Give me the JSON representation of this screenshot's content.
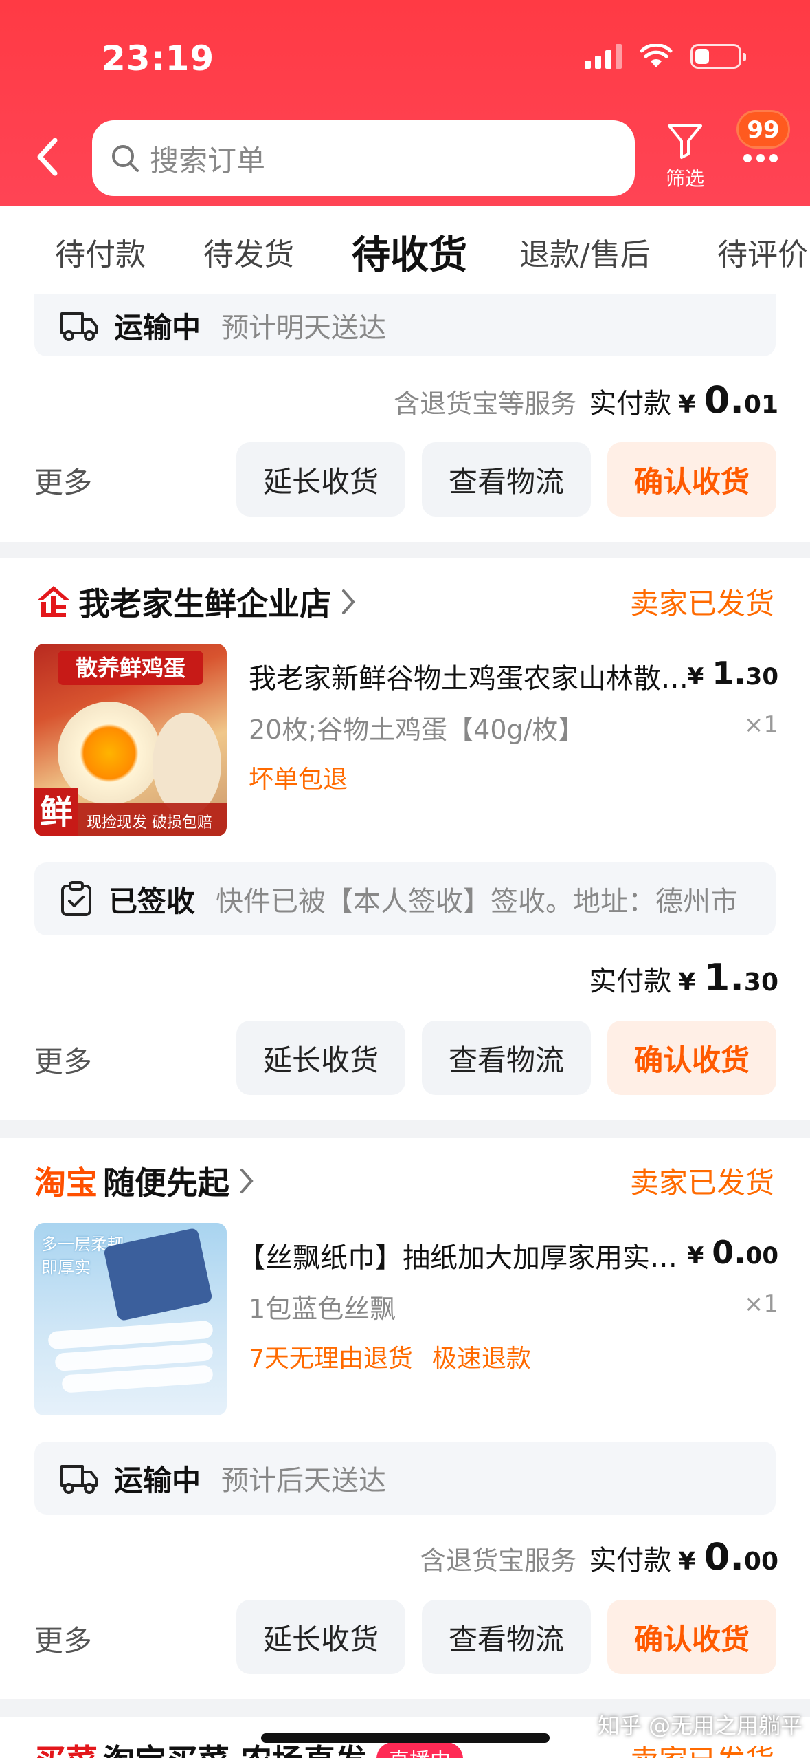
{
  "status_bar": {
    "time": "23:19"
  },
  "header": {
    "search_placeholder": "搜索订单",
    "filter_label": "筛选",
    "message_count": "99"
  },
  "tabs": [
    {
      "label": "待付款"
    },
    {
      "label": "待发货"
    },
    {
      "label": "待收货",
      "active": true
    },
    {
      "label": "退款/售后"
    },
    {
      "label": "待评价"
    }
  ],
  "orders": [
    {
      "logistics_status": "运输中",
      "logistics_desc": "预计明天送达",
      "service_note": "含退货宝等服务",
      "paid_label": "实付款",
      "currency": "¥",
      "paid_int": "0.",
      "paid_dec": "01",
      "more": "更多",
      "btn_extend": "延长收货",
      "btn_logistics": "查看物流",
      "btn_confirm": "确认收货"
    },
    {
      "shop_badge": "企",
      "shop_name": "我老家生鲜企业店",
      "shipped": "卖家已发货",
      "product_title": "我老家新鲜谷物土鸡蛋农家山林散养鸡蛋",
      "product_img_banner": "散养鲜鸡蛋",
      "product_img_corner": "鲜",
      "product_img_caption": "现捡现发 破损包赔",
      "currency": "¥",
      "price_int": "1.",
      "price_dec": "30",
      "sku": "20枚;谷物土鸡蛋【40g/枚】",
      "qty": "×1",
      "tags": [
        "坏单包退"
      ],
      "logistics_status": "已签收",
      "logistics_desc": "快件已被【本人签收】签收。地址：德州市",
      "paid_label": "实付款",
      "paid_int": "1.",
      "paid_dec": "30",
      "more": "更多",
      "btn_extend": "延长收货",
      "btn_logistics": "查看物流",
      "btn_confirm": "确认收货"
    },
    {
      "shop_badge": "淘宝",
      "shop_name": "随便先起",
      "shipped": "卖家已发货",
      "product_title": "【丝飘纸巾】抽纸加大加厚家用实惠装",
      "product_img_text": "多一层柔韧\n即厚实",
      "currency": "¥",
      "price_int": "0.",
      "price_dec": "00",
      "sku": "1包蓝色丝飘",
      "qty": "×1",
      "tags": [
        "7天无理由退货",
        "极速退款"
      ],
      "logistics_status": "运输中",
      "logistics_desc": "预计后天送达",
      "service_note": "含退货宝服务",
      "paid_label": "实付款",
      "paid_int": "0.",
      "paid_dec": "00",
      "more": "更多",
      "btn_extend": "延长收货",
      "btn_logistics": "查看物流",
      "btn_confirm": "确认收货"
    },
    {
      "shop_badge": "买菜",
      "shop_name": "淘宝买菜 农场直发",
      "live_badge": "直播中",
      "shipped": "卖家已发货"
    }
  ],
  "watermark": "知乎 @无用之用躺平",
  "colors": {
    "header_red": "#ff3a44",
    "accent_orange": "#ff6a00",
    "confirm_bg": "#ffefe6"
  }
}
